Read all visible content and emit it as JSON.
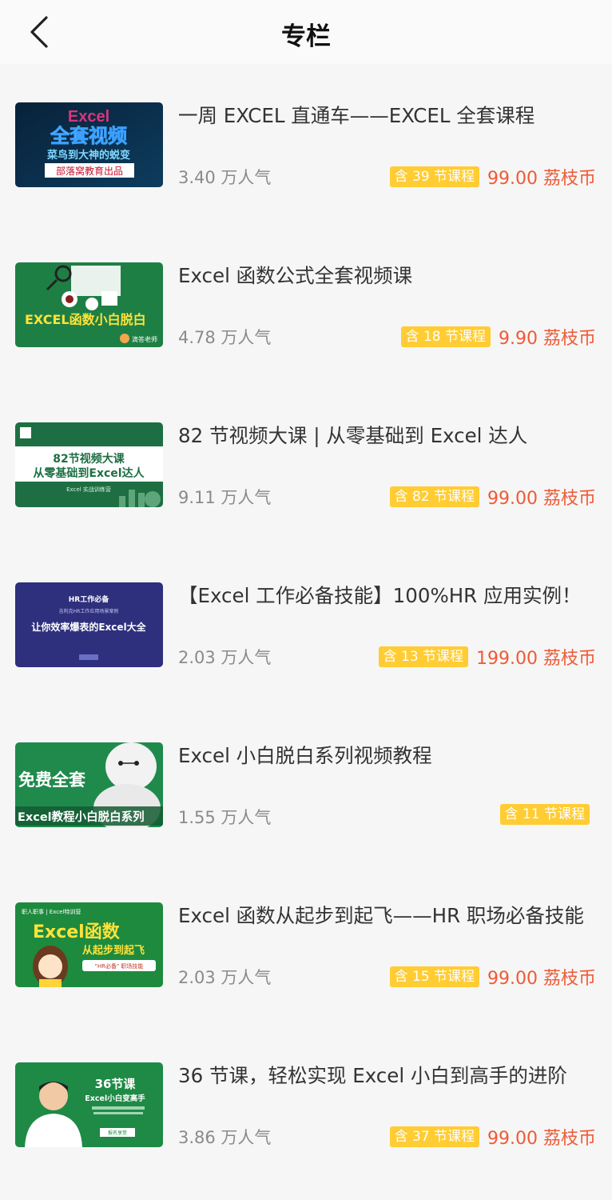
{
  "header": {
    "title": "专栏",
    "back_icon": "chevron-left-icon"
  },
  "courses": [
    {
      "title": "一周 EXCEL 直通车——EXCEL 全套课程",
      "popularity": "3.40 万人气",
      "lessons": "含 39 节课程",
      "price": "99.00 荔枝币",
      "thumb": {
        "line1": "Excel",
        "line2": "全套视频",
        "line3": "菜鸟到大神的蜕变",
        "line4": "部落窝教育出品"
      }
    },
    {
      "title": "Excel 函数公式全套视频课",
      "popularity": "4.78 万人气",
      "lessons": "含 18 节课程",
      "price": "9.90 荔枝币",
      "thumb": {
        "line1": "EXCEL函数小白脱白",
        "line2": "滴答老师"
      }
    },
    {
      "title": "82 节视频大课 | 从零基础到 Excel 达人",
      "popularity": "9.11 万人气",
      "lessons": "含 82 节课程",
      "price": "99.00 荔枝币",
      "thumb": {
        "line1": "82节视频大课",
        "line2": "从零基础到Excel达人",
        "line3": "Excel 实战训练营"
      }
    },
    {
      "title": "【Excel 工作必备技能】100%HR 应用实例！",
      "popularity": "2.03 万人气",
      "lessons": "含 13 节课程",
      "price": "199.00 荔枝币",
      "thumb": {
        "line1": "HR工作必备",
        "line2": "吉利克HR工作应用场景案例",
        "line3": "让你效率爆表的Excel大全"
      }
    },
    {
      "title": "Excel 小白脱白系列视频教程",
      "popularity": "1.55 万人气",
      "lessons": "含 11 节课程",
      "price": "",
      "thumb": {
        "line1": "免费全套",
        "line2": "Excel教程小白脱白系列"
      }
    },
    {
      "title": "Excel 函数从起步到起飞——HR 职场必备技能",
      "popularity": "2.03 万人气",
      "lessons": "含 15 节课程",
      "price": "99.00 荔枝币",
      "thumb": {
        "line1": "职人职事 | Excel特训营",
        "line2": "Excel函数",
        "line3": "从起步到起飞",
        "line4": "\"HR必备\" 职场技能"
      }
    },
    {
      "title": "36 节课，轻松实现 Excel 小白到高手的进阶",
      "popularity": "3.86 万人气",
      "lessons": "含 37 节课程",
      "price": "99.00 荔枝币",
      "thumb": {
        "line1": "36节课",
        "line2": "Excel小白变高手",
        "line3": "报名享受"
      }
    }
  ]
}
